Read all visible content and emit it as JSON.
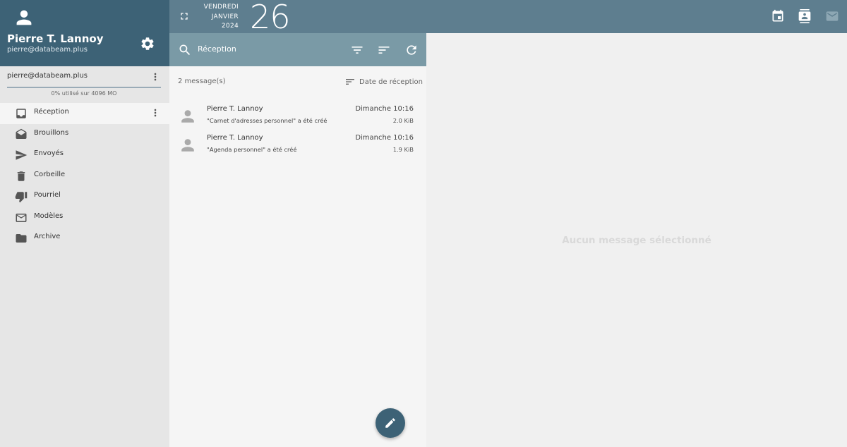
{
  "user": {
    "name": "Pierre T. Lannoy",
    "email": "pierre@databeam.plus"
  },
  "account": {
    "email": "pierre@databeam.plus",
    "quota": "0% utilisé sur 4096 MO"
  },
  "folders": [
    {
      "label": "Réception",
      "icon": "inbox-icon",
      "active": true
    },
    {
      "label": "Brouillons",
      "icon": "drafts-icon",
      "active": false
    },
    {
      "label": "Envoyés",
      "icon": "send-icon",
      "active": false
    },
    {
      "label": "Corbeille",
      "icon": "trash-icon",
      "active": false
    },
    {
      "label": "Pourriel",
      "icon": "spam-icon",
      "active": false
    },
    {
      "label": "Modèles",
      "icon": "template-icon",
      "active": false
    },
    {
      "label": "Archive",
      "icon": "archive-icon",
      "active": false
    }
  ],
  "topbar": {
    "weekday": "VENDREDI",
    "month": "JANVIER",
    "year": "2024",
    "day": "26"
  },
  "list": {
    "title": "Réception",
    "count": "2 message(s)",
    "sort_label": "Date de réception",
    "messages": [
      {
        "sender": "Pierre T. Lannoy",
        "subject": "\"Carnet d'adresses personnel\" a été créé",
        "date": "Dimanche 10:16",
        "size": "2.0 KiB"
      },
      {
        "sender": "Pierre T. Lannoy",
        "subject": "\"Agenda personnel\" a été créé",
        "date": "Dimanche 10:16",
        "size": "1.9 KiB"
      }
    ]
  },
  "reading": {
    "empty_text": "Aucun message sélectionné"
  },
  "colors": {
    "profile_bg": "#3d6276",
    "topbar_bg": "#5e7e8f",
    "listhead_bg": "#7a9aa6",
    "accent": "#3d6276"
  }
}
